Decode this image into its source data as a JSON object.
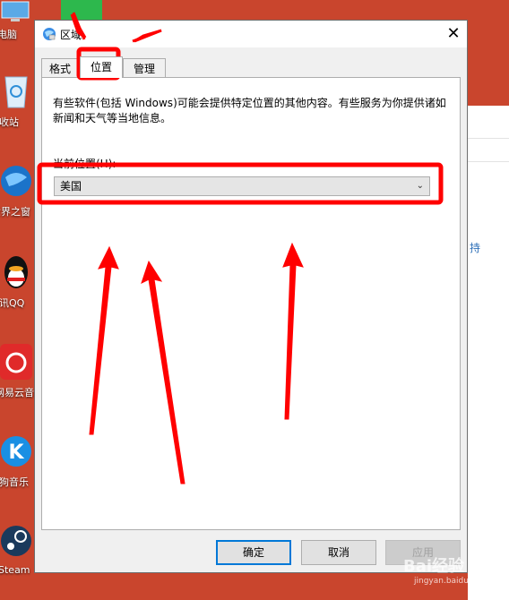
{
  "desktop": {
    "icons": [
      {
        "label": "此电脑",
        "icon": "computer-icon"
      },
      {
        "label": "回收站",
        "icon": "recycle-bin-icon"
      },
      {
        "label": "世界之窗",
        "icon": "browser-globe-icon"
      },
      {
        "label": "腾讯QQ",
        "icon": "qq-penguin-icon"
      },
      {
        "label": "网易云音乐",
        "icon": "netease-music-icon"
      },
      {
        "label": "酷狗音乐",
        "icon": "kugou-icon"
      },
      {
        "label": "Steam",
        "icon": "steam-icon"
      }
    ],
    "background_color": "#c9452d"
  },
  "background_window": {
    "link_text": "持"
  },
  "dialog": {
    "title": "区域",
    "close_glyph": "✕",
    "tabs": [
      {
        "label": "格式"
      },
      {
        "label": "位置"
      },
      {
        "label": "管理"
      }
    ],
    "active_tab": "位置",
    "description": "有些软件(包括 Windows)可能会提供特定位置的其他内容。有些服务为你提供诸如新闻和天气等当地信息。",
    "location_label": "当前位置(H):",
    "location_value": "美国",
    "buttons": {
      "ok": "确定",
      "cancel": "取消",
      "apply": "应用"
    }
  },
  "watermark": {
    "text": "Bai经验",
    "sub": "jingyan.baidu.com"
  },
  "annotation_color": "#ff0000"
}
